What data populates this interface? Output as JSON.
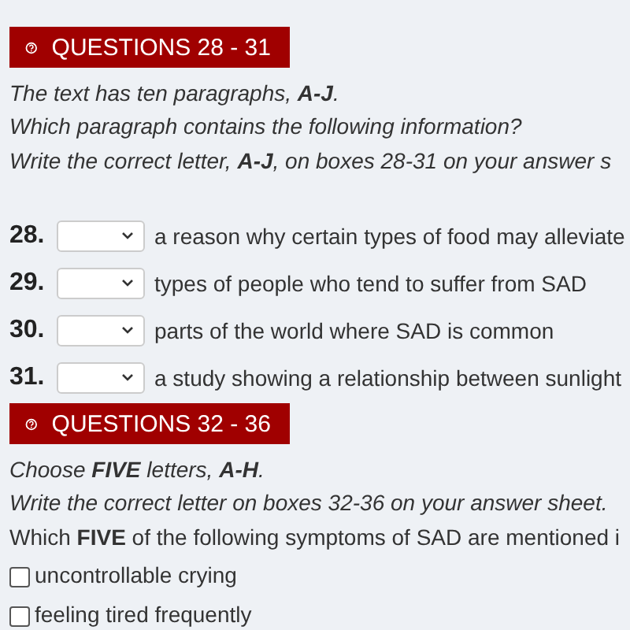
{
  "sections": [
    {
      "heading": "QUESTIONS 28 - 31",
      "instructions": [
        {
          "text": "The text has ten paragraphs, **A-J**.",
          "italic": true
        },
        {
          "text": "Which paragraph contains the following information?",
          "italic": true
        },
        {
          "text": "Write the correct letter, **A-J**, on boxes 28-31 on your answer s",
          "italic": true
        }
      ],
      "questions": [
        {
          "kind": "select",
          "number": "28.",
          "text": "a reason why certain types of food may alleviate"
        },
        {
          "kind": "select",
          "number": "29.",
          "text": "types of people who tend to suffer from SAD"
        },
        {
          "kind": "select",
          "number": "30.",
          "text": "parts of the world where SAD is common"
        },
        {
          "kind": "select",
          "number": "31.",
          "text": "a study showing a relationship between sunlight"
        }
      ]
    },
    {
      "heading": "QUESTIONS 32 - 36",
      "instructions": [
        {
          "text": "Choose **FIVE** letters, **A-H**.",
          "italic": true
        },
        {
          "text": "Write the correct letter on boxes 32-36 on your answer sheet.",
          "italic": true
        },
        {
          "text": "Which **FIVE** of the following symptoms of SAD are mentioned i",
          "italic": false
        }
      ],
      "questions": [
        {
          "kind": "checkbox",
          "text": "uncontrollable crying",
          "checked": false
        },
        {
          "kind": "checkbox",
          "text": "feeling tired frequently",
          "checked": false
        }
      ]
    }
  ]
}
